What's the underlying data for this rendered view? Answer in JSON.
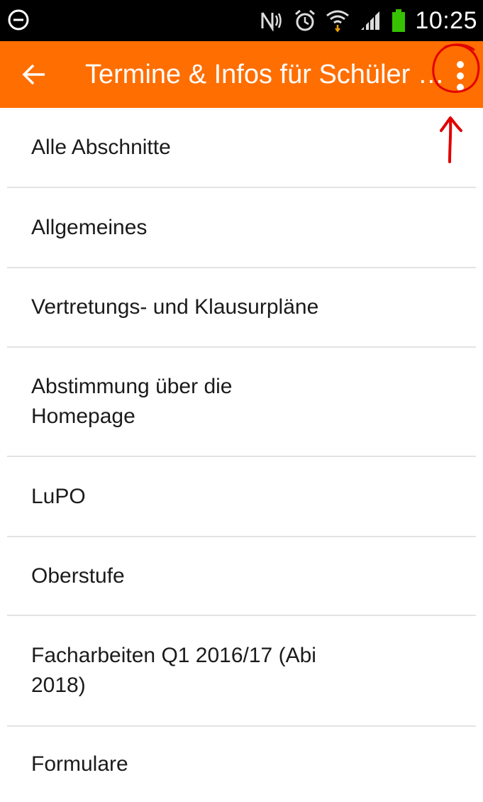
{
  "status_bar": {
    "time": "10:25",
    "icons": [
      "do-not-disturb-icon",
      "nfc-icon",
      "alarm-icon",
      "wifi-icon",
      "signal-icon",
      "battery-icon"
    ]
  },
  "action_bar": {
    "title": "Termine & Infos für Schüler und Eltern",
    "background_color": "#ff6e00",
    "back_icon": "arrow-back-icon",
    "overflow_icon": "overflow-menu-icon"
  },
  "list": {
    "items": [
      {
        "label": "Alle Abschnitte"
      },
      {
        "label": "Allgemeines"
      },
      {
        "label": "Vertretungs- und Klausurpläne"
      },
      {
        "label": "Abstimmung über die Homepage"
      },
      {
        "label": "LuPO"
      },
      {
        "label": "Oberstufe"
      },
      {
        "label": "Facharbeiten Q1 2016/17 (Abi 2018)"
      },
      {
        "label": "Formulare"
      }
    ]
  },
  "annotation": {
    "color": "#e00000",
    "shape": "circle-and-arrow"
  }
}
